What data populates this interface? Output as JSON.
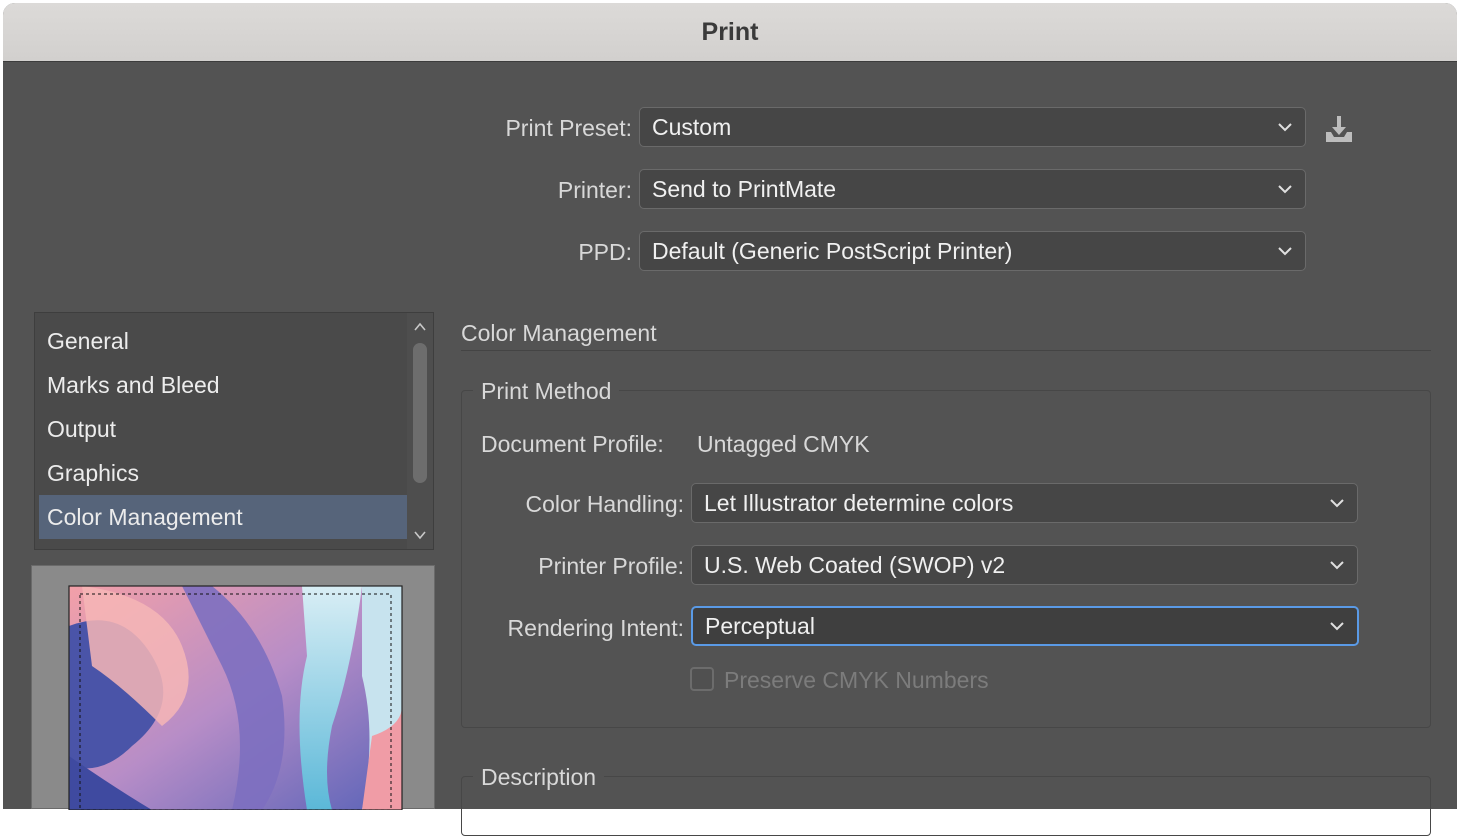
{
  "window": {
    "title": "Print"
  },
  "top": {
    "print_preset": {
      "label": "Print Preset:",
      "value": "Custom"
    },
    "printer": {
      "label": "Printer:",
      "value": "Send to PrintMate"
    },
    "ppd": {
      "label": "PPD:",
      "value": "Default (Generic PostScript Printer)"
    }
  },
  "sidebar": {
    "items": [
      {
        "label": "General",
        "selected": false
      },
      {
        "label": "Marks and Bleed",
        "selected": false
      },
      {
        "label": "Output",
        "selected": false
      },
      {
        "label": "Graphics",
        "selected": false
      },
      {
        "label": "Color Management",
        "selected": true
      }
    ]
  },
  "color_management": {
    "section_title": "Color Management",
    "print_method": {
      "title": "Print Method",
      "document_profile_label": "Document Profile:",
      "document_profile_value": "Untagged CMYK",
      "color_handling": {
        "label": "Color Handling:",
        "value": "Let Illustrator determine colors"
      },
      "printer_profile": {
        "label": "Printer Profile:",
        "value": "U.S. Web Coated (SWOP) v2"
      },
      "rendering_intent": {
        "label": "Rendering Intent:",
        "value": "Perceptual"
      },
      "preserve_cmyk": {
        "label": "Preserve CMYK Numbers",
        "checked": false,
        "enabled": false
      }
    },
    "description": {
      "title": "Description"
    }
  },
  "colors": {
    "window_bg": "#535353",
    "selection": "#56647a",
    "focus_ring": "#5a9ae6"
  }
}
